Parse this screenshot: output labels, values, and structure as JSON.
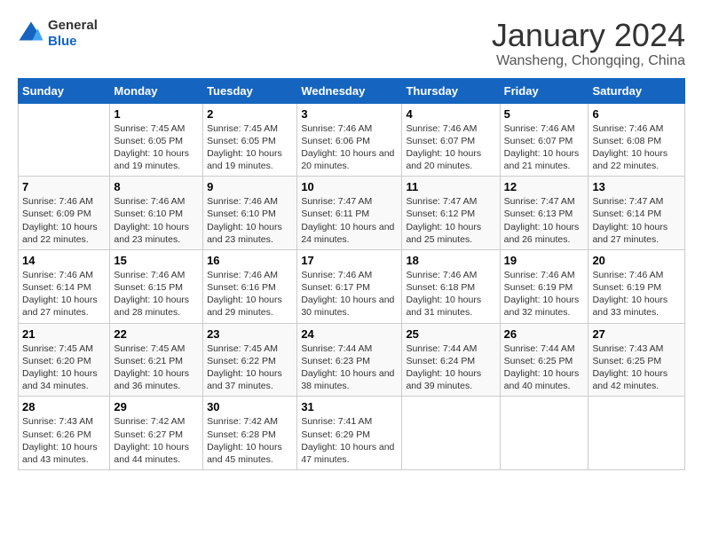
{
  "header": {
    "logo_line1": "General",
    "logo_line2": "Blue",
    "title": "January 2024",
    "subtitle": "Wansheng, Chongqing, China"
  },
  "days_of_week": [
    "Sunday",
    "Monday",
    "Tuesday",
    "Wednesday",
    "Thursday",
    "Friday",
    "Saturday"
  ],
  "weeks": [
    [
      {
        "day": "",
        "sunrise": "",
        "sunset": "",
        "daylight": ""
      },
      {
        "day": "1",
        "sunrise": "Sunrise: 7:45 AM",
        "sunset": "Sunset: 6:05 PM",
        "daylight": "Daylight: 10 hours and 19 minutes."
      },
      {
        "day": "2",
        "sunrise": "Sunrise: 7:45 AM",
        "sunset": "Sunset: 6:05 PM",
        "daylight": "Daylight: 10 hours and 19 minutes."
      },
      {
        "day": "3",
        "sunrise": "Sunrise: 7:46 AM",
        "sunset": "Sunset: 6:06 PM",
        "daylight": "Daylight: 10 hours and 20 minutes."
      },
      {
        "day": "4",
        "sunrise": "Sunrise: 7:46 AM",
        "sunset": "Sunset: 6:07 PM",
        "daylight": "Daylight: 10 hours and 20 minutes."
      },
      {
        "day": "5",
        "sunrise": "Sunrise: 7:46 AM",
        "sunset": "Sunset: 6:07 PM",
        "daylight": "Daylight: 10 hours and 21 minutes."
      },
      {
        "day": "6",
        "sunrise": "Sunrise: 7:46 AM",
        "sunset": "Sunset: 6:08 PM",
        "daylight": "Daylight: 10 hours and 22 minutes."
      }
    ],
    [
      {
        "day": "7",
        "sunrise": "Sunrise: 7:46 AM",
        "sunset": "Sunset: 6:09 PM",
        "daylight": "Daylight: 10 hours and 22 minutes."
      },
      {
        "day": "8",
        "sunrise": "Sunrise: 7:46 AM",
        "sunset": "Sunset: 6:10 PM",
        "daylight": "Daylight: 10 hours and 23 minutes."
      },
      {
        "day": "9",
        "sunrise": "Sunrise: 7:46 AM",
        "sunset": "Sunset: 6:10 PM",
        "daylight": "Daylight: 10 hours and 23 minutes."
      },
      {
        "day": "10",
        "sunrise": "Sunrise: 7:47 AM",
        "sunset": "Sunset: 6:11 PM",
        "daylight": "Daylight: 10 hours and 24 minutes."
      },
      {
        "day": "11",
        "sunrise": "Sunrise: 7:47 AM",
        "sunset": "Sunset: 6:12 PM",
        "daylight": "Daylight: 10 hours and 25 minutes."
      },
      {
        "day": "12",
        "sunrise": "Sunrise: 7:47 AM",
        "sunset": "Sunset: 6:13 PM",
        "daylight": "Daylight: 10 hours and 26 minutes."
      },
      {
        "day": "13",
        "sunrise": "Sunrise: 7:47 AM",
        "sunset": "Sunset: 6:14 PM",
        "daylight": "Daylight: 10 hours and 27 minutes."
      }
    ],
    [
      {
        "day": "14",
        "sunrise": "Sunrise: 7:46 AM",
        "sunset": "Sunset: 6:14 PM",
        "daylight": "Daylight: 10 hours and 27 minutes."
      },
      {
        "day": "15",
        "sunrise": "Sunrise: 7:46 AM",
        "sunset": "Sunset: 6:15 PM",
        "daylight": "Daylight: 10 hours and 28 minutes."
      },
      {
        "day": "16",
        "sunrise": "Sunrise: 7:46 AM",
        "sunset": "Sunset: 6:16 PM",
        "daylight": "Daylight: 10 hours and 29 minutes."
      },
      {
        "day": "17",
        "sunrise": "Sunrise: 7:46 AM",
        "sunset": "Sunset: 6:17 PM",
        "daylight": "Daylight: 10 hours and 30 minutes."
      },
      {
        "day": "18",
        "sunrise": "Sunrise: 7:46 AM",
        "sunset": "Sunset: 6:18 PM",
        "daylight": "Daylight: 10 hours and 31 minutes."
      },
      {
        "day": "19",
        "sunrise": "Sunrise: 7:46 AM",
        "sunset": "Sunset: 6:19 PM",
        "daylight": "Daylight: 10 hours and 32 minutes."
      },
      {
        "day": "20",
        "sunrise": "Sunrise: 7:46 AM",
        "sunset": "Sunset: 6:19 PM",
        "daylight": "Daylight: 10 hours and 33 minutes."
      }
    ],
    [
      {
        "day": "21",
        "sunrise": "Sunrise: 7:45 AM",
        "sunset": "Sunset: 6:20 PM",
        "daylight": "Daylight: 10 hours and 34 minutes."
      },
      {
        "day": "22",
        "sunrise": "Sunrise: 7:45 AM",
        "sunset": "Sunset: 6:21 PM",
        "daylight": "Daylight: 10 hours and 36 minutes."
      },
      {
        "day": "23",
        "sunrise": "Sunrise: 7:45 AM",
        "sunset": "Sunset: 6:22 PM",
        "daylight": "Daylight: 10 hours and 37 minutes."
      },
      {
        "day": "24",
        "sunrise": "Sunrise: 7:44 AM",
        "sunset": "Sunset: 6:23 PM",
        "daylight": "Daylight: 10 hours and 38 minutes."
      },
      {
        "day": "25",
        "sunrise": "Sunrise: 7:44 AM",
        "sunset": "Sunset: 6:24 PM",
        "daylight": "Daylight: 10 hours and 39 minutes."
      },
      {
        "day": "26",
        "sunrise": "Sunrise: 7:44 AM",
        "sunset": "Sunset: 6:25 PM",
        "daylight": "Daylight: 10 hours and 40 minutes."
      },
      {
        "day": "27",
        "sunrise": "Sunrise: 7:43 AM",
        "sunset": "Sunset: 6:25 PM",
        "daylight": "Daylight: 10 hours and 42 minutes."
      }
    ],
    [
      {
        "day": "28",
        "sunrise": "Sunrise: 7:43 AM",
        "sunset": "Sunset: 6:26 PM",
        "daylight": "Daylight: 10 hours and 43 minutes."
      },
      {
        "day": "29",
        "sunrise": "Sunrise: 7:42 AM",
        "sunset": "Sunset: 6:27 PM",
        "daylight": "Daylight: 10 hours and 44 minutes."
      },
      {
        "day": "30",
        "sunrise": "Sunrise: 7:42 AM",
        "sunset": "Sunset: 6:28 PM",
        "daylight": "Daylight: 10 hours and 45 minutes."
      },
      {
        "day": "31",
        "sunrise": "Sunrise: 7:41 AM",
        "sunset": "Sunset: 6:29 PM",
        "daylight": "Daylight: 10 hours and 47 minutes."
      },
      {
        "day": "",
        "sunrise": "",
        "sunset": "",
        "daylight": ""
      },
      {
        "day": "",
        "sunrise": "",
        "sunset": "",
        "daylight": ""
      },
      {
        "day": "",
        "sunrise": "",
        "sunset": "",
        "daylight": ""
      }
    ]
  ]
}
